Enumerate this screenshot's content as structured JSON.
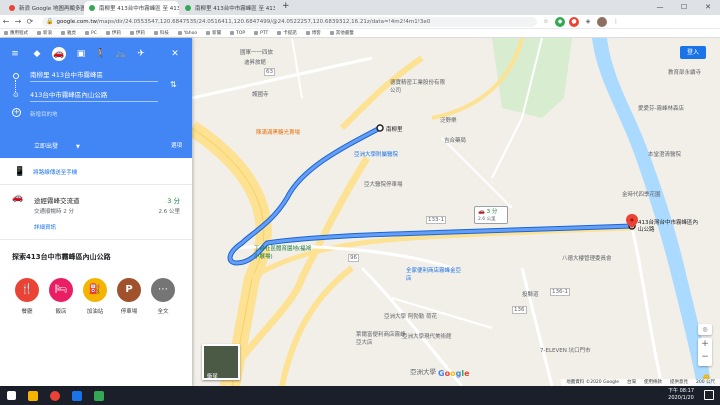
{
  "browser": {
    "tabs": [
      {
        "title": "新浪 Google 地圖再顯多圖層: Go...",
        "active": false
      },
      {
        "title": "南柳里 413台中市霧峰區 至 413...",
        "active": true
      },
      {
        "title": "南柳里 413台中市霧峰區 至 413...",
        "active": false
      }
    ],
    "new_tab": "+",
    "url_host": "google.com.tw",
    "url_path": "/maps/dir/24.0553547,120.6847535/24.0516411,120.6847499/@24.0522257,120.6839312,16.21z/data=!4m2!4m1!3e0",
    "bookmarks": [
      "應用程式",
      "新浪",
      "雅虎",
      "PC",
      "伊莉",
      "伊莉",
      "科技",
      "Yahoo",
      "新聞",
      "TOP",
      "PTT",
      "卡提諾",
      "博客",
      "其他書籤"
    ]
  },
  "panel": {
    "from": "南柳里 413台中市霧峰區",
    "to": "413台中市霧峰區內山公路",
    "add_destination": "新增目的地",
    "leave_now": "立即出發",
    "options": "選項",
    "send_to_phone": "將路線傳送至手機",
    "route": {
      "name": "途經霧峰交流道",
      "duration": "3 分",
      "note": "交通順暢時 2 分",
      "distance": "2.6 公里",
      "details": "詳細資訊"
    },
    "explore_title": "探索413台中市霧峰區內山公路",
    "categories": [
      {
        "label": "餐廳",
        "icon": "restaurant-icon",
        "color": "#ea4335"
      },
      {
        "label": "飯店",
        "icon": "hotel-icon",
        "color": "#e91e63"
      },
      {
        "label": "加油站",
        "icon": "gas-station-icon",
        "color": "#f4b400"
      },
      {
        "label": "停車場",
        "icon": "parking-icon",
        "color": "#a0522d"
      },
      {
        "label": "全文",
        "icon": "more-icon",
        "color": "#757575"
      }
    ]
  },
  "map": {
    "login": "登入",
    "callout_time": "3 分",
    "callout_dist": "2.6 公里",
    "start_label": "南柳里",
    "dest_label": "413台灣台中市霧峰區內山公路",
    "layer_label": "衛星",
    "places": {
      "p1": "國軍一一四旅",
      "p2": "迪昇旅館",
      "p3": "護國寺",
      "p4": "德寶精密工業股份有限公司",
      "p5": "陳滿滿黑糖光賣場",
      "p6": "亞洲大學附屬醫院",
      "p7": "亞大醫院停車場",
      "p8": "丁台社區體育園地(福鴻小展場)",
      "p9": "全家便利商店霧峰金亞店",
      "p10": "亞洲大學 阿勃勒 荷花",
      "p11": "亞洲大學現代美術館",
      "p12": "萊爾富便利商店霧峰亞大店",
      "p13": "亞洲大學",
      "p14": "八德大樓管理委員會",
      "p15": "金時代四季花園",
      "p16": "本堂澄清醫院",
      "p17": "愛愛芬-霧峰林森店",
      "p18": "7-ELEVEN 坑口門市",
      "p19": "教育部永續寺",
      "p20": "泛野樂",
      "p21": "吉合藥局"
    },
    "roads": [
      "63",
      "96",
      "133-1",
      "136",
      "136-1",
      "投縣道"
    ],
    "footer": [
      "地圖資料 ©2020 Google",
      "台灣",
      "使用條款",
      "提供意見",
      "200 公尺"
    ]
  },
  "taskbar": {
    "time": "下午 08:17",
    "date": "2020/1/20"
  }
}
